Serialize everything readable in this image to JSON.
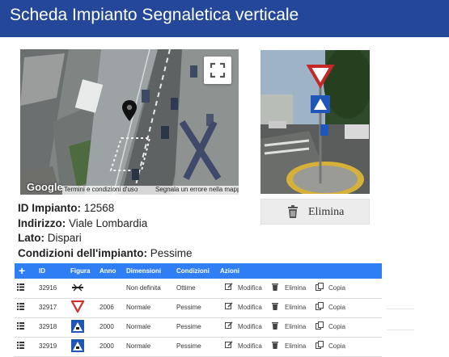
{
  "header": {
    "title": "Scheda Impianto Segnaletica verticale"
  },
  "map": {
    "logo": "Google",
    "terms": "Termini e condizioni d'uso",
    "report": "Segnala un errore nella mappa",
    "fullscreen_icon": "fullscreen-icon",
    "marker_icon": "map-marker-icon"
  },
  "photo": {
    "delete_label": "Elimina",
    "delete_icon": "trash-icon"
  },
  "info": {
    "id_label": "ID Impianto:",
    "id_value": " 12568",
    "address_label": "Indirizzo:",
    "address_value": " Viale Lombardia",
    "side_label": "Lato:",
    "side_value": " Dispari",
    "cond_label": "Condizioni dell'impianto:",
    "cond_value": " Pessime"
  },
  "table": {
    "header_color": "#2f7ef3",
    "add_symbol": "+",
    "columns": [
      "ID",
      "Figura",
      "Anno",
      "Dimensioni",
      "Condizioni",
      "Azioni"
    ],
    "rows": [
      {
        "id": "32916",
        "figure": "no-parking-sign",
        "year": "",
        "dimension": "Non definita",
        "condition": "Ottime"
      },
      {
        "id": "32917",
        "figure": "give-way-sign",
        "year": "2006",
        "dimension": "Normale",
        "condition": "Pessime"
      },
      {
        "id": "32918",
        "figure": "pedestrian-crossing-sign",
        "year": "2000",
        "dimension": "Normale",
        "condition": "Pessime"
      },
      {
        "id": "32919",
        "figure": "pedestrian-crossing-sign",
        "year": "2000",
        "dimension": "Normale",
        "condition": "Pessime"
      }
    ],
    "actions": {
      "edit": "Modifica",
      "delete": "Elimina",
      "copy": "Copia"
    }
  }
}
